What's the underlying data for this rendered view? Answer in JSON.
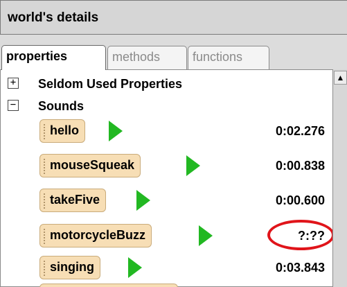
{
  "panel": {
    "title": "world's details",
    "tabs": [
      {
        "label": "properties",
        "selected": true
      },
      {
        "label": "methods",
        "selected": false
      },
      {
        "label": "functions",
        "selected": false
      }
    ]
  },
  "tree": {
    "groups": [
      {
        "label": "Seldom Used Properties",
        "expander": "+",
        "expanded": false
      },
      {
        "label": "Sounds",
        "expander": "−",
        "expanded": true
      }
    ],
    "sounds": [
      {
        "name": "hello",
        "duration": "0:02.276"
      },
      {
        "name": "mouseSqueak",
        "duration": "0:00.838"
      },
      {
        "name": "takeFive",
        "duration": "0:00.600"
      },
      {
        "name": "motorcycleBuzz",
        "duration": "?:??",
        "highlighted": true
      },
      {
        "name": "singing",
        "duration": "0:03.843"
      }
    ]
  },
  "scrollbar": {
    "up_arrow": "▲"
  },
  "colors": {
    "tile_fill": "#f7deb5",
    "play_green": "#22b822",
    "highlight_red": "#e0141a",
    "panel_gray": "#d6d6d6"
  },
  "icons": {
    "play": "play-icon",
    "expand": "plus-icon",
    "collapse": "minus-icon",
    "scroll_up": "arrow-up-icon"
  }
}
